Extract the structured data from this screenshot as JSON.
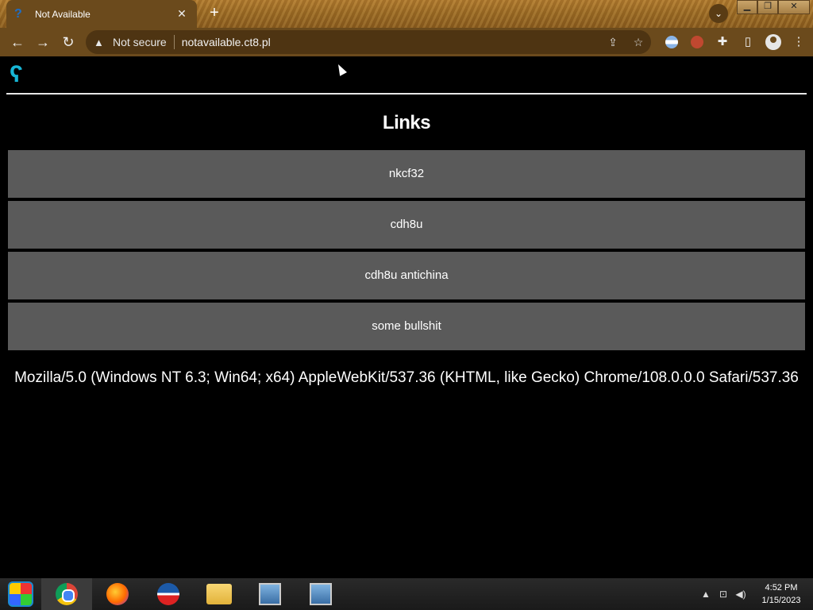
{
  "browser": {
    "tab": {
      "favicon": "?",
      "title": "Not Available",
      "close": "✕"
    },
    "new_tab": "+",
    "tab_search": "⌄",
    "window_controls": {
      "minimize": "▁",
      "restore": "❐",
      "close": "✕"
    },
    "nav": {
      "back": "←",
      "forward": "→",
      "reload": "↻"
    },
    "omnibox": {
      "warning_icon": "▲",
      "security_label": "Not secure",
      "url": "notavailable.ct8.pl",
      "share_icon": "⇪",
      "bookmark_icon": "☆"
    },
    "extensions": {
      "puzzle": "✚",
      "sidepanel": "▯",
      "menu": "⋮"
    }
  },
  "page": {
    "logo": "ʕ",
    "heading": "Links",
    "links": [
      {
        "label": "nkcf32"
      },
      {
        "label": "cdh8u"
      },
      {
        "label": "cdh8u antichina"
      },
      {
        "label": "some bullshit"
      }
    ],
    "user_agent": "Mozilla/5.0 (Windows NT 6.3; Win64; x64) AppleWebKit/537.36 (KHTML, like Gecko) Chrome/108.0.0.0 Safari/537.36"
  },
  "taskbar": {
    "tray": {
      "show_hidden": "▲",
      "network": "⊡",
      "volume": "◀)"
    },
    "clock": {
      "time": "4:52 PM",
      "date": "1/15/2023"
    }
  }
}
